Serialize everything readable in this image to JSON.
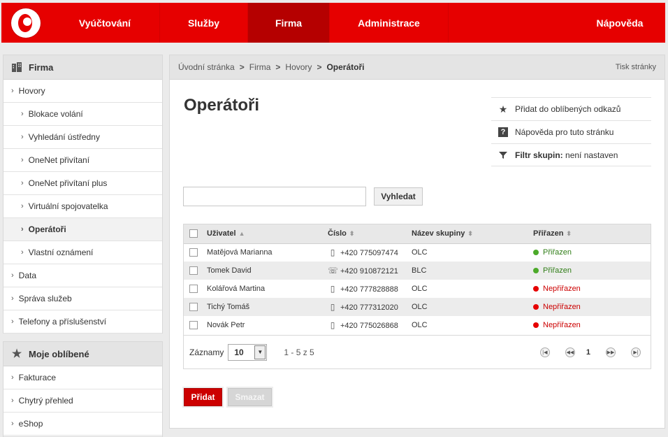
{
  "nav": {
    "items": [
      "Vyúčtování",
      "Služby",
      "Firma",
      "Administrace",
      "Nápověda"
    ],
    "active": "Firma",
    "accent_color": "#e60000"
  },
  "sidebar": {
    "section1": {
      "title": "Firma",
      "icon": "building-icon",
      "items": [
        {
          "label": "Hovory",
          "level": 1
        },
        {
          "label": "Blokace volání",
          "level": 2
        },
        {
          "label": "Vyhledání ústředny",
          "level": 2
        },
        {
          "label": "OneNet přivítaní",
          "level": 2
        },
        {
          "label": "OneNet přivítaní plus",
          "level": 2
        },
        {
          "label": "Virtuální spojovatelka",
          "level": 2
        },
        {
          "label": "Operátoři",
          "level": 2,
          "active": true
        },
        {
          "label": "Vlastní oznámení",
          "level": 2
        },
        {
          "label": "Data",
          "level": 1
        },
        {
          "label": "Správa služeb",
          "level": 1
        },
        {
          "label": "Telefony a příslušenství",
          "level": 1
        }
      ]
    },
    "section2": {
      "title": "Moje oblíbené",
      "icon": "star-icon",
      "items": [
        {
          "label": "Fakturace"
        },
        {
          "label": "Chytrý přehled"
        },
        {
          "label": "eShop"
        }
      ]
    }
  },
  "breadcrumb": {
    "items": [
      "Úvodní stránka",
      "Firma",
      "Hovory"
    ],
    "current": "Operátoři",
    "separator": ">",
    "print_label": "Tisk stránky"
  },
  "page": {
    "title": "Operátoři"
  },
  "actions": {
    "favorite": "Přidat do oblíbených odkazů",
    "help": "Nápověda pro tuto stránku",
    "filter_label": "Filtr skupin:",
    "filter_value": "není nastaven"
  },
  "search": {
    "value": "",
    "button": "Vyhledat"
  },
  "table": {
    "headers": {
      "user": "Uživatel",
      "number": "Číslo",
      "group": "Název skupiny",
      "assigned": "Přiřazen"
    },
    "rows": [
      {
        "user": "Matějová Marianna",
        "number": "+420 775097474",
        "device": "mobile-phone-icon",
        "group": "OLC",
        "status": "Přiřazen",
        "ok": true
      },
      {
        "user": "Tomek David",
        "number": "+420 910872121",
        "device": "landline-phone-icon",
        "group": "BLC",
        "status": "Přiřazen",
        "ok": true
      },
      {
        "user": "Kolářová Martina",
        "number": "+420 777828888",
        "device": "mobile-phone-icon",
        "group": "OLC",
        "status": "Nepřiřazen",
        "ok": false
      },
      {
        "user": "Tichý Tomáš",
        "number": "+420 777312020",
        "device": "mobile-phone-icon",
        "group": "OLC",
        "status": "Nepřiřazen",
        "ok": false
      },
      {
        "user": "Novák Petr",
        "number": "+420 775026868",
        "device": "mobile-phone-icon",
        "group": "OLC",
        "status": "Nepřiřazen",
        "ok": false
      }
    ],
    "status_colors": {
      "ok": "#4caa2a",
      "no": "#e60000"
    }
  },
  "footer": {
    "records_label": "Záznamy",
    "page_size": "10",
    "range": "1 - 5 z 5",
    "current_page": "1"
  },
  "buttons": {
    "add": "Přidat",
    "delete": "Smazat"
  }
}
